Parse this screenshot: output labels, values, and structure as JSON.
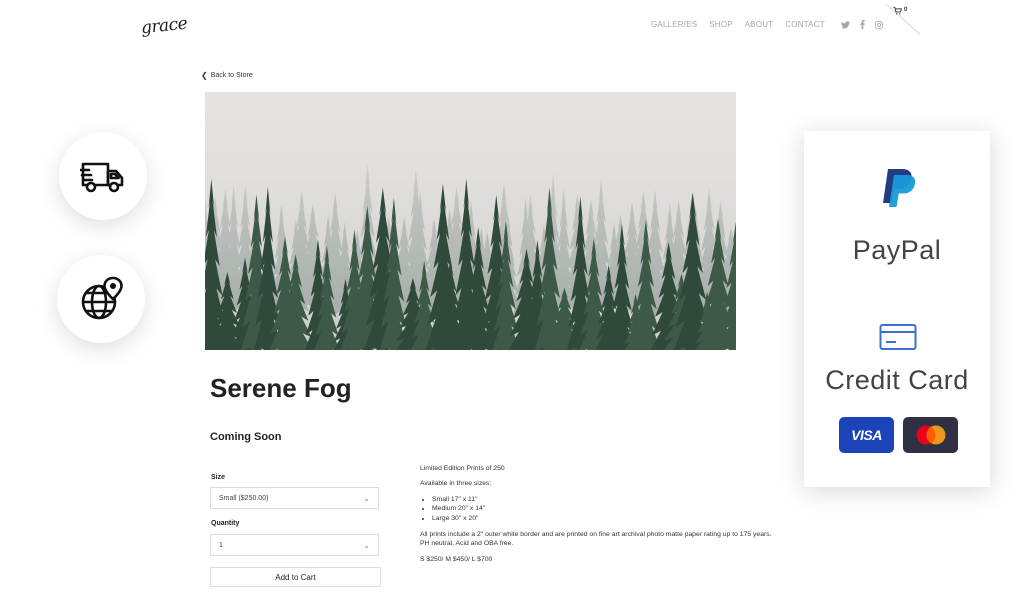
{
  "header": {
    "logo_text": "grace",
    "nav": [
      "GALLERIES",
      "SHOP",
      "ABOUT",
      "CONTACT"
    ],
    "social_icons": [
      "twitter-icon",
      "facebook-icon",
      "instagram-icon"
    ],
    "cart_count": "0"
  },
  "back_link": "Back to Store",
  "product": {
    "title": "Serene Fog",
    "status": "Coming Soon",
    "size_label": "Size",
    "size_value": "Small ($250.00)",
    "quantity_label": "Quantity",
    "quantity_value": "1",
    "add_to_cart": "Add to Cart"
  },
  "description": {
    "line1": "Limited Edition Prints of 250",
    "line2": "Available in three sizes:",
    "sizes": [
      "Small 17\" x 11\"",
      "Medium 20\" x 14\"",
      "Large 30\" x 20\""
    ],
    "line3": "All prints include a 2\" outer white border and are printed on fine art archival photo matte paper rating up to 175 years. PH neutral, Acid and OBA free.",
    "line4": "S $250/ M $450/ L $700"
  },
  "badges": [
    "delivery-truck-icon",
    "globe-location-icon"
  ],
  "payment": {
    "paypal_label": "PayPal",
    "credit_card_label": "Credit Card",
    "visa_text": "VISA",
    "colors": {
      "paypal_dark": "#253b80",
      "paypal_light": "#179bd7",
      "visa_blue": "#1a44b8",
      "mc_red": "#eb001b",
      "mc_orange": "#f79e1b"
    }
  }
}
